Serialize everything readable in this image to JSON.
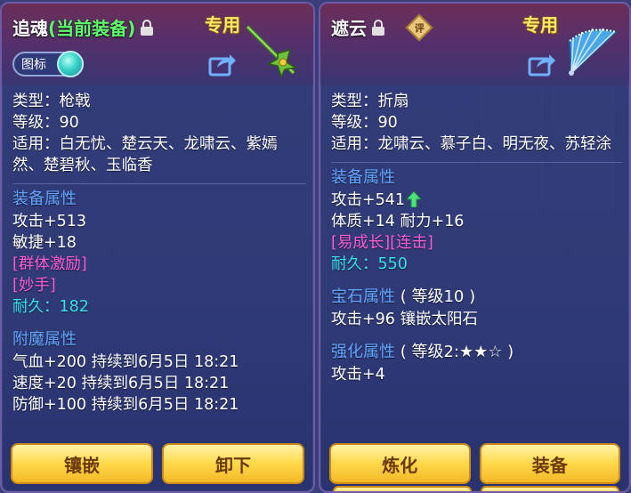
{
  "left_panel": {
    "name": "追魂",
    "equipped_tag": "(当前装备)",
    "special": "专用",
    "icon_toggle_label": "图标",
    "type": "类型：枪戟",
    "level": "等级：90",
    "applicable": "适用：白无忧、楚云天、龙啸云、紫嫣然、楚碧秋、玉临香",
    "equip_attr_title": "装备属性",
    "attrs": [
      "攻击+513",
      "敏捷+18"
    ],
    "skill1": "[群体激励]",
    "skill2": "[妙手]",
    "durability_label": "耐久：",
    "durability_value": "182",
    "enchant_title": "附魔属性",
    "enchants": [
      "气血+200 持续到6月5日 18:21",
      "速度+20 持续到6月5日 18:21",
      "防御+100 持续到6月5日 18:21"
    ],
    "buttons": [
      "镶嵌",
      "卸下"
    ]
  },
  "right_panel": {
    "name": "遮云",
    "review_badge": "评",
    "special": "专用",
    "type": "类型：折扇",
    "level": "等级：90",
    "applicable": "适用：龙啸云、慕子白、明无夜、苏轻涂",
    "equip_attr_title": "装备属性",
    "attack": "攻击+541",
    "attrs2": "体质+14 耐力+16",
    "skills": "[易成长][连击]",
    "durability_label": "耐久：",
    "durability_value": "550",
    "gem_title": "宝石属性",
    "gem_level": "( 等级10 )",
    "gem_attr": "攻击+96 镶嵌太阳石",
    "strengthen_title": "强化属性",
    "strengthen_level": "( 等级2:★★☆ )",
    "strengthen_attr": "攻击+4",
    "buttons": [
      "炼化",
      "装备"
    ]
  },
  "colors": {
    "section_title": "#63a5ff",
    "equipped": "#5dff6a",
    "skill": "#ff5dd8",
    "durability": "#37e2ee",
    "special": "#ffe86a",
    "button": "#ffd84a"
  }
}
